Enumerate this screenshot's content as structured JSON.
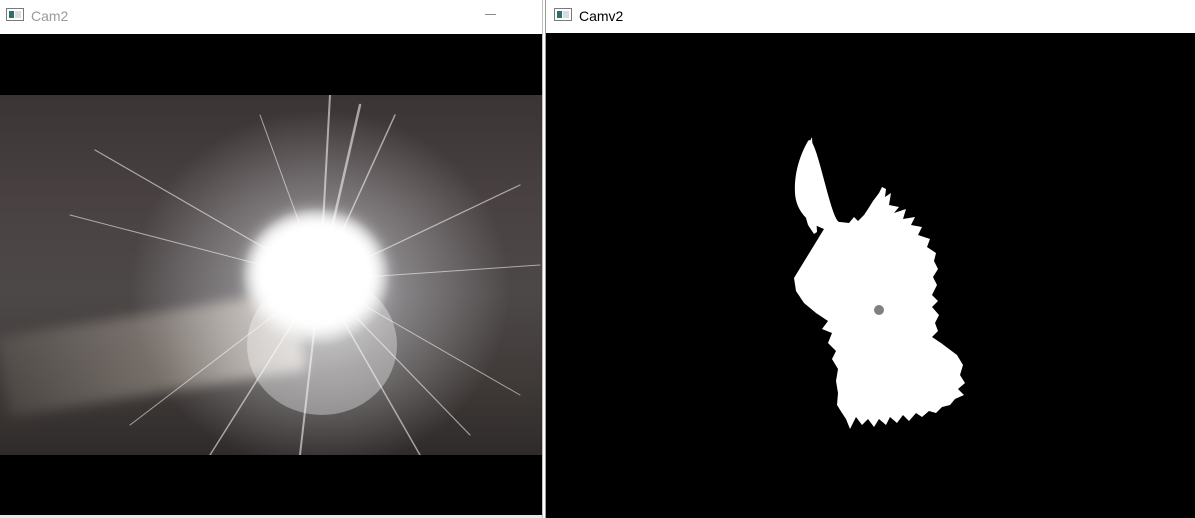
{
  "windows": {
    "left": {
      "title": "Cam2"
    },
    "right": {
      "title": "Camv2"
    }
  },
  "icons": {
    "left_app_icon": "opencv-window-icon",
    "right_app_icon": "opencv-window-icon",
    "minimize": "minimize-icon"
  },
  "colors": {
    "title_active": "#000000",
    "title_inactive": "#9a9a9a",
    "canvas_background": "#000000",
    "mask_foreground": "#ffffff",
    "centroid_marker": "#808080"
  }
}
